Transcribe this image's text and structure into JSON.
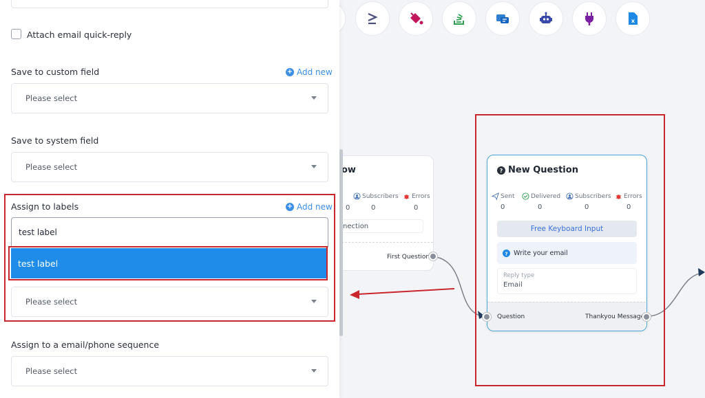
{
  "sidebar": {
    "attach_quick_reply_label": "Attach email quick-reply",
    "custom_field": {
      "label": "Save to custom field",
      "add_new": "Add new",
      "placeholder": "Please select"
    },
    "system_field": {
      "label": "Save to system field",
      "placeholder": "Please select"
    },
    "labels": {
      "label": "Assign to labels",
      "add_new": "Add new",
      "input_value": "test label",
      "dropdown_option": "test label",
      "placeholder": "Please select"
    },
    "sequence": {
      "label": "Assign to a email/phone sequence",
      "placeholder": "Please select"
    }
  },
  "toolbar": {
    "icons": [
      "greater-equal-icon",
      "paint-bucket-icon",
      "stackoverflow-icon",
      "message-icon",
      "robot-icon",
      "plug-icon",
      "excel-icon"
    ]
  },
  "card_left": {
    "title_fragment": "ow",
    "stats": [
      {
        "label": "Subscribers",
        "value": "0"
      },
      {
        "label": "Errors",
        "value": "0"
      }
    ],
    "first_stat_value": "0",
    "connection_text": "nection",
    "output_label": "First Question"
  },
  "card_right": {
    "title": "New Question",
    "stats": [
      {
        "label": "Sent",
        "value": "0"
      },
      {
        "label": "Delivered",
        "value": "0"
      },
      {
        "label": "Subscribers",
        "value": "0"
      },
      {
        "label": "Errors",
        "value": "0"
      }
    ],
    "keyboard_button": "Free Keyboard Input",
    "message": "Write your email",
    "reply_type_label": "Reply type",
    "reply_type_value": "Email",
    "input_label": "Question",
    "output_label": "Thankyou Message"
  },
  "colors": {
    "accent": "#1e8ce8",
    "annotation_red": "#c9252c",
    "link_blue": "#3a8ee6"
  }
}
